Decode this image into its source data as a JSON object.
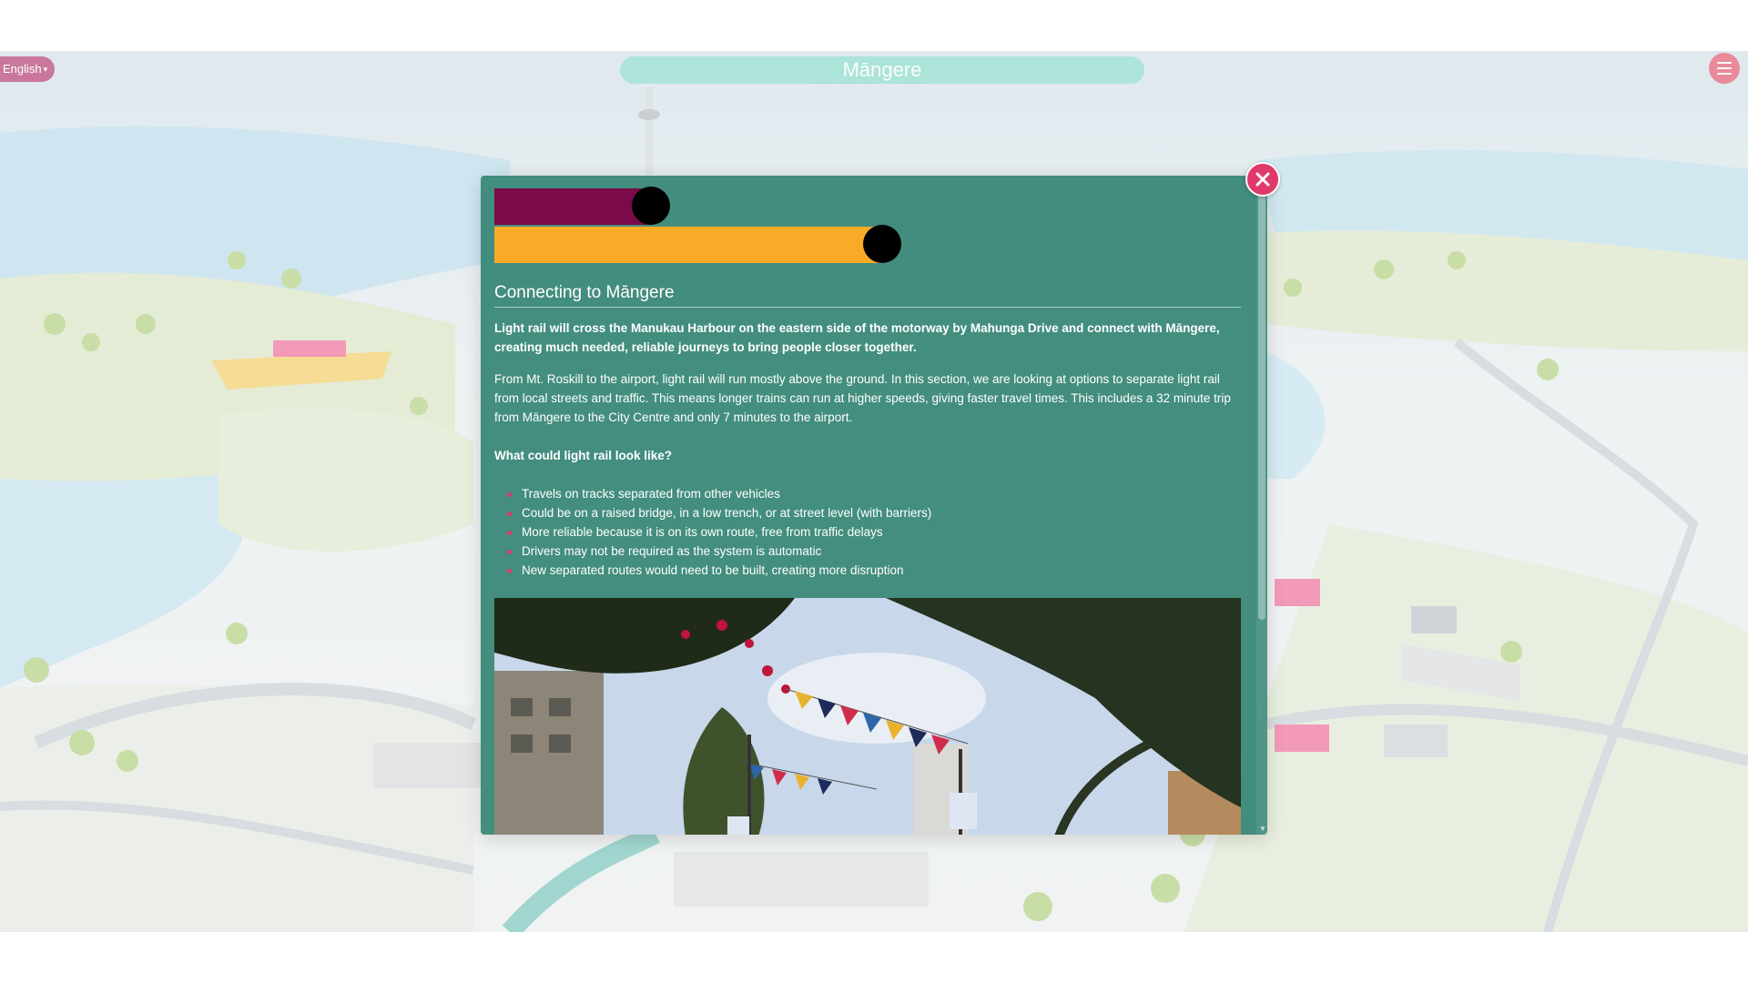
{
  "header": {
    "language": "English",
    "title": "Māngere"
  },
  "modal": {
    "progress": {
      "bar1": {
        "value": 0.21,
        "color": "#7a0a4a"
      },
      "bar2": {
        "value": 0.52,
        "color": "#f9ab27"
      }
    },
    "heading": "Connecting to Māngere",
    "intro": "Light rail will cross the Manukau Harbour on the eastern side of the motorway by Mahunga Drive and connect with Māngere, creating much needed, reliable journeys to bring people closer together.",
    "body": "From Mt. Roskill to the airport, light rail will run mostly above the ground. In this section, we are looking at options to separate light rail from local streets and traffic. This means longer trains can run at higher speeds, giving faster travel times. This includes a 32 minute trip from Māngere to the City Centre and only 7 minutes to the airport.",
    "question": "What could light rail look like?",
    "features": [
      "Travels on tracks separated from other vehicles",
      "Could be on a raised bridge, in a low trench, or at street level (with barriers)",
      "More reliable because it is on its own route, free from traffic delays",
      "Drivers may not be required as the system is automatic",
      "New separated routes would need to be built, creating more disruption"
    ]
  },
  "icons": {
    "close": "close-icon",
    "menu": "hamburger-icon",
    "language": "chevron-down-icon"
  },
  "colors": {
    "modal_bg": "#388776",
    "accent_pink": "#e0396a",
    "title_pill": "#a8e4d8",
    "language_pill": "#c9789c"
  }
}
